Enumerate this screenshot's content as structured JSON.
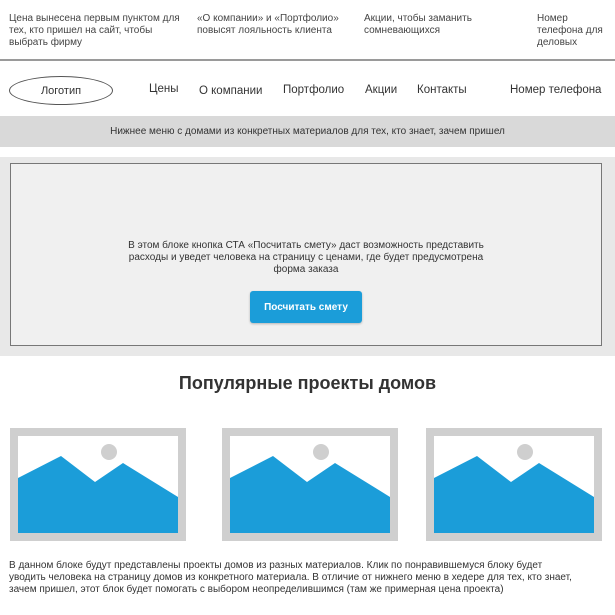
{
  "annotations": {
    "prices_note": "Цена вынесена первым пунктом для тех, кто пришел на сайт, чтобы выбрать фирму",
    "about_note": "«О компании» и «Портфолио» повысят лояльность клиента",
    "promo_note": "Акции, чтобы заманить сомневающихся",
    "phone_note": "Номер телефона для деловых"
  },
  "header": {
    "logo": "Логотип",
    "nav": {
      "prices": "Цены",
      "about": "О компании",
      "portfolio": "Портфолио",
      "promo": "Акции",
      "contacts": "Контакты",
      "phone": "Номер телефона"
    }
  },
  "submenu": {
    "text": "Нижнее меню с домами из конкретных материалов для тех, кто знает, зачем пришел"
  },
  "hero": {
    "text": "В этом блоке кнопка СТА «Посчитать смету» даст возможность представить расходы и уведет человека на страницу с ценами, где будет предусмотрена форма заказа",
    "cta_label": "Посчитать смету"
  },
  "projects": {
    "title": "Популярные проекты домов",
    "description": "В данном блоке будут представлены проекты домов из разных материалов. Клик по понравившемуся блоку будет уводить человека на страницу домов из конкретного материала. В отличие от нижнего меню в хедере для тех, кто знает, зачем пришел, этот блок будет помогать с выбором неопределившимся (там же примерная цена проекта)"
  },
  "colors": {
    "accent": "#1b9dd9",
    "placeholder_frame": "#cfcfcf",
    "submenu_bg": "#d9d9d9"
  },
  "icons": {
    "card_image": "image-placeholder-icon"
  }
}
